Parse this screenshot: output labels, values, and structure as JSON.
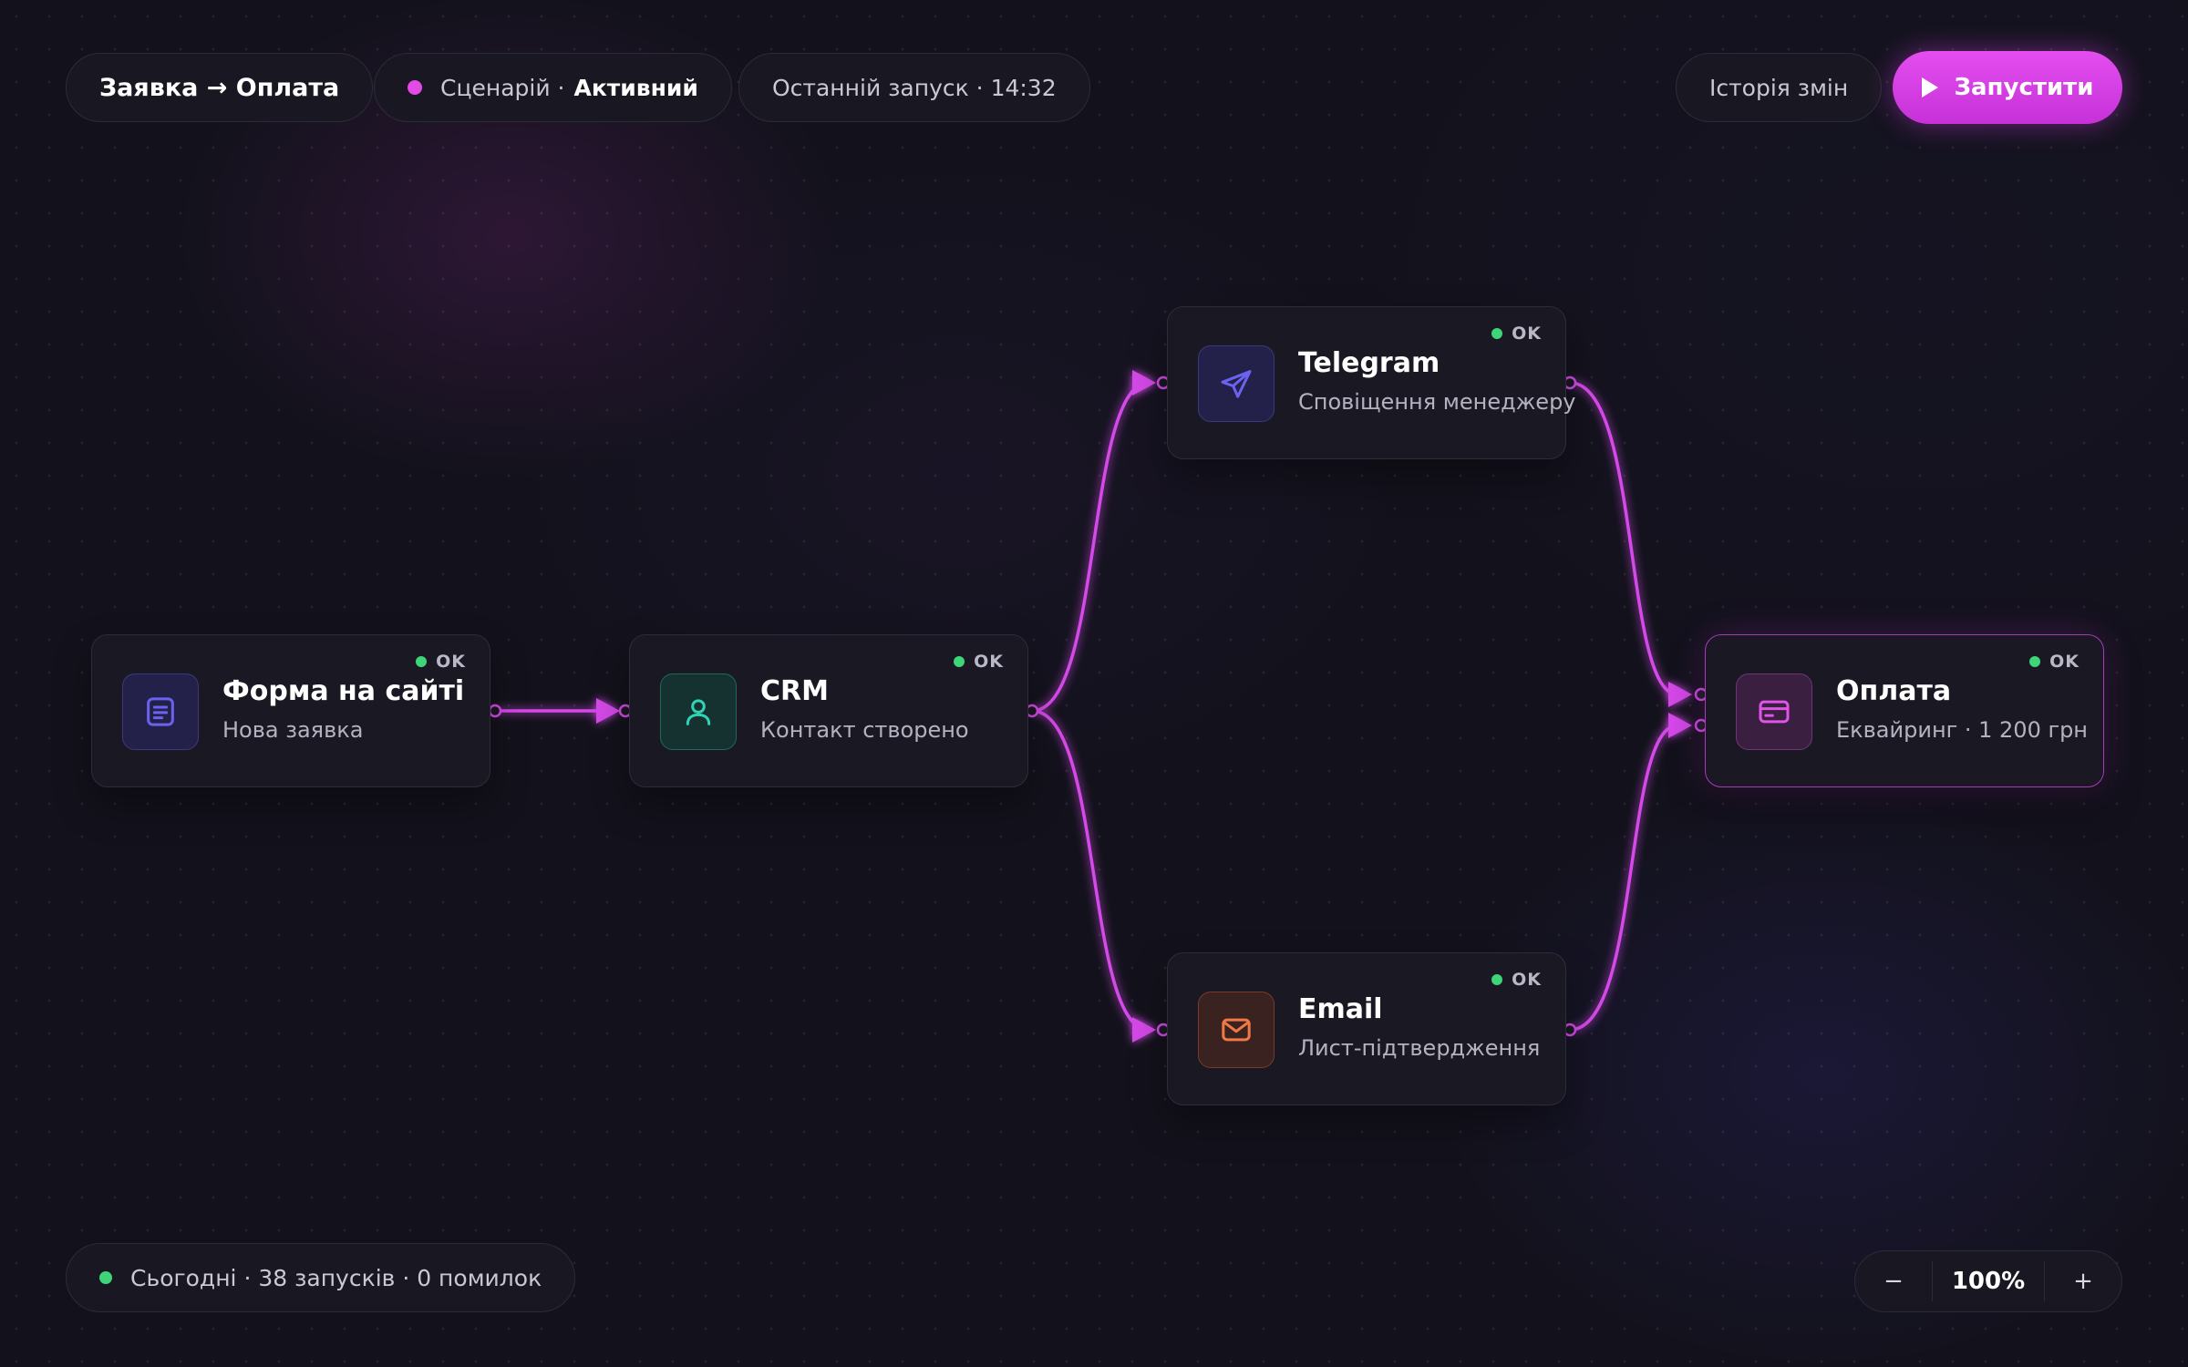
{
  "header": {
    "title": "Заявка → Оплата",
    "status_prefix": "Сценарій ·",
    "status_value": "Активний",
    "last_run": "Останній запуск · 14:32",
    "history_label": "Історія змін",
    "run_label": "Запустити"
  },
  "nodes": [
    {
      "id": "form",
      "title": "Форма на сайті",
      "subtitle": "Нова заявка",
      "status": "OK",
      "icon": "form-icon"
    },
    {
      "id": "crm",
      "title": "CRM",
      "subtitle": "Контакт створено",
      "status": "OK",
      "icon": "user-icon"
    },
    {
      "id": "telegram",
      "title": "Telegram",
      "subtitle": "Сповіщення менеджеру",
      "status": "OK",
      "icon": "paper-plane-icon"
    },
    {
      "id": "email",
      "title": "Email",
      "subtitle": "Лист-підтвердження",
      "status": "OK",
      "icon": "mail-icon"
    },
    {
      "id": "payment",
      "title": "Оплата",
      "subtitle": "Еквайринг · 1 200 грн",
      "status": "OK",
      "icon": "credit-card-icon"
    }
  ],
  "footer": {
    "stats": "Сьогодні · 38 запусків · 0 помилок",
    "zoom_value": "100%",
    "zoom_out": "−",
    "zoom_in": "+"
  },
  "colors": {
    "accent": "#d946ef",
    "ok": "#3ed478",
    "background": "#13121c"
  }
}
